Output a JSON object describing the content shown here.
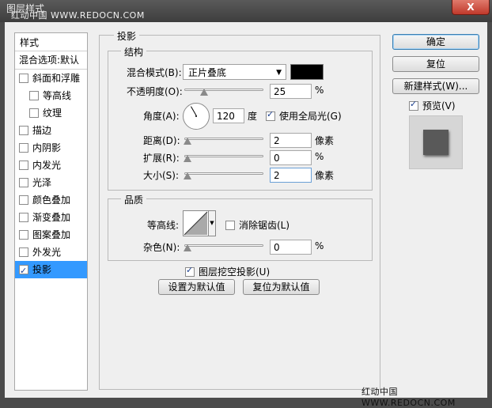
{
  "window": {
    "title": "图层样式",
    "watermark_top": "红动中国 WWW.REDOCN.COM",
    "watermark_bottom": "红动中国 WWW.REDOCN.COM",
    "close_label": "X"
  },
  "styles_list": {
    "header": "样式",
    "blend_options": "混合选项:默认",
    "items": [
      {
        "label": "斜面和浮雕",
        "checked": false
      },
      {
        "label": "等高线",
        "checked": false
      },
      {
        "label": "纹理",
        "checked": false
      },
      {
        "label": "描边",
        "checked": false
      },
      {
        "label": "内阴影",
        "checked": false
      },
      {
        "label": "内发光",
        "checked": false
      },
      {
        "label": "光泽",
        "checked": false
      },
      {
        "label": "颜色叠加",
        "checked": false
      },
      {
        "label": "渐变叠加",
        "checked": false
      },
      {
        "label": "图案叠加",
        "checked": false
      },
      {
        "label": "外发光",
        "checked": false
      },
      {
        "label": "投影",
        "checked": true,
        "selected": true
      }
    ]
  },
  "drop_shadow": {
    "title": "投影",
    "structure": {
      "title": "结构",
      "blend_mode_label": "混合模式(B):",
      "blend_mode_value": "正片叠底",
      "shadow_color": "#000000",
      "opacity_label": "不透明度(O):",
      "opacity_value": "25",
      "opacity_level": 0.25,
      "angle_label": "角度(A):",
      "angle_value": "120",
      "angle_unit": "度",
      "global_light_label": "使用全局光(G)",
      "global_light_checked": true,
      "distance_label": "距离(D):",
      "distance_value": "2",
      "distance_unit": "像素",
      "spread_label": "扩展(R):",
      "spread_value": "0",
      "size_label": "大小(S):",
      "size_value": "2",
      "size_unit": "像素",
      "percent": "%"
    },
    "quality": {
      "title": "品质",
      "contour_label": "等高线:",
      "antialias_label": "消除锯齿(L)",
      "antialias_checked": false,
      "noise_label": "杂色(N):",
      "noise_value": "0",
      "percent": "%"
    },
    "knockout_label": "图层挖空投影(U)",
    "knockout_checked": true,
    "set_default": "设置为默认值",
    "reset_default": "复位为默认值"
  },
  "side_buttons": {
    "ok": "确定",
    "reset": "复位",
    "new_style": "新建样式(W)...",
    "preview_label": "预览(V)",
    "preview_checked": true
  }
}
